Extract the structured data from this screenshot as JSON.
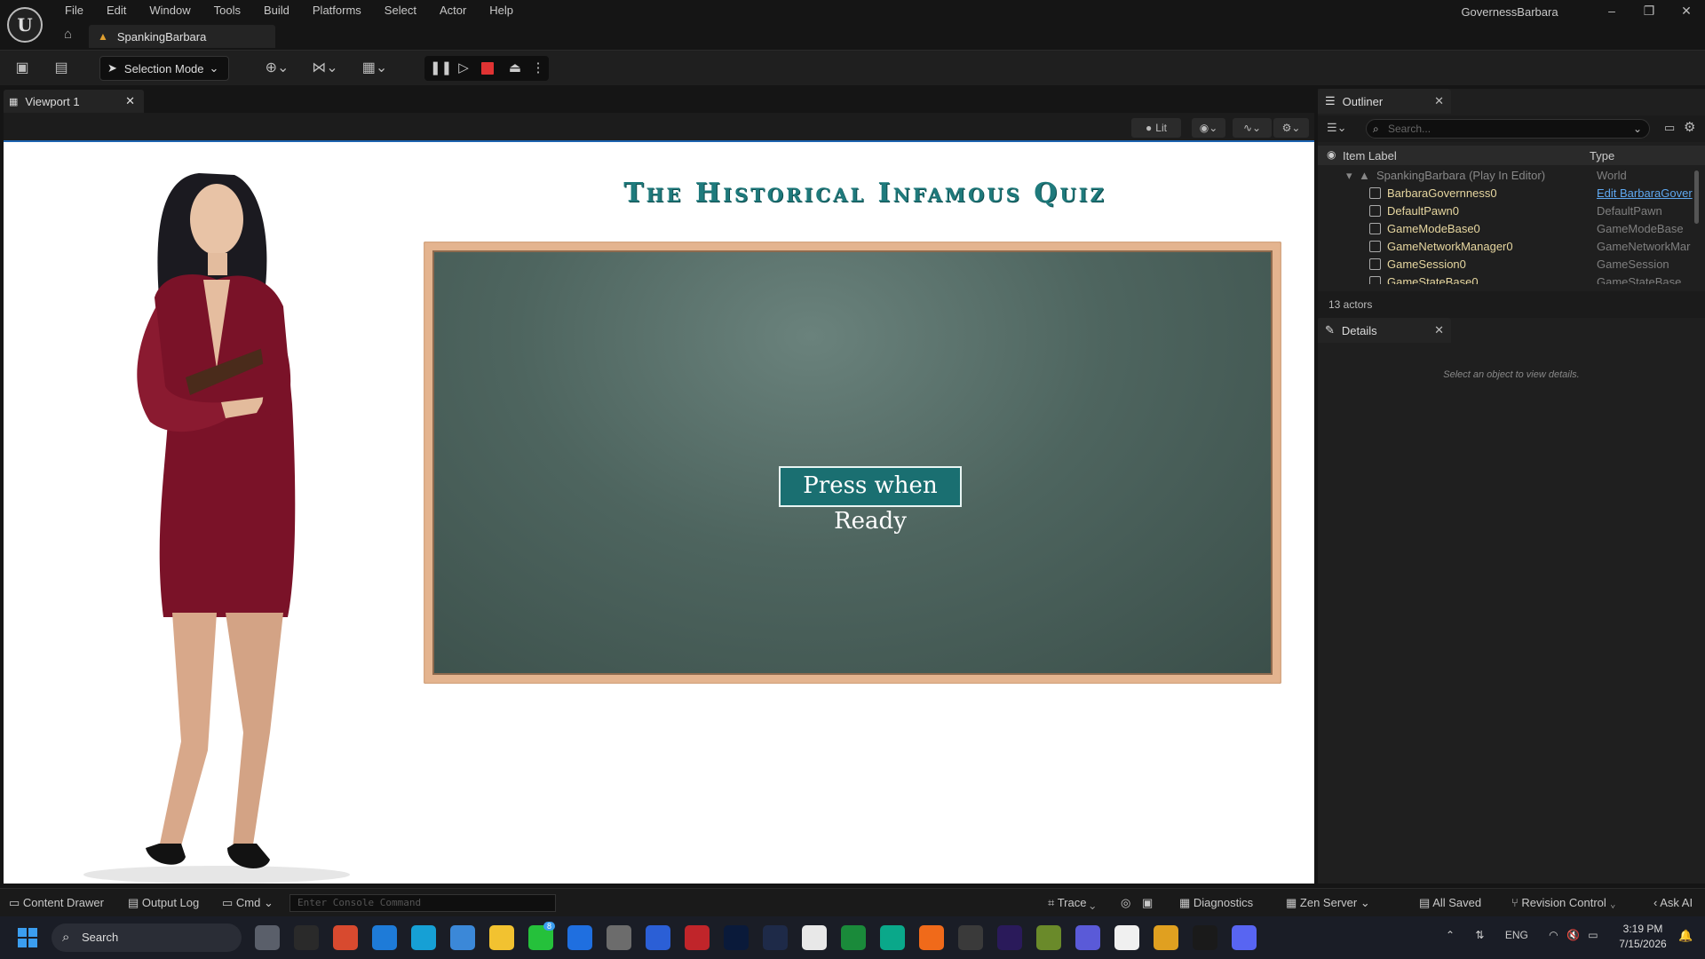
{
  "app": {
    "logo_letter": "U",
    "menus": [
      "File",
      "Edit",
      "Window",
      "Tools",
      "Build",
      "Platforms",
      "Select",
      "Actor",
      "Help"
    ],
    "level_tab": "SpankingBarbara",
    "project_name": "GovernessBarbara",
    "window_controls": {
      "minimize": "–",
      "restore": "❐",
      "close": "✕"
    }
  },
  "toolbar": {
    "mode_label": "Selection Mode"
  },
  "viewport": {
    "tab_label": "Viewport 1",
    "lit_label": "Lit"
  },
  "game": {
    "title": "The Historical Infamous Quiz",
    "button_label": "Press when Ready"
  },
  "outliner": {
    "tab_label": "Outliner",
    "search_placeholder": "Search...",
    "col_label": "Item Label",
    "col_type": "Type",
    "world": {
      "label": "SpankingBarbara (Play In Editor)",
      "type": "World"
    },
    "rows": [
      {
        "label": "BarbaraGovernness0",
        "type": "Edit BarbaraGover",
        "link": true
      },
      {
        "label": "DefaultPawn0",
        "type": "DefaultPawn"
      },
      {
        "label": "GameModeBase0",
        "type": "GameModeBase"
      },
      {
        "label": "GameNetworkManager0",
        "type": "GameNetworkMar"
      },
      {
        "label": "GameSession0",
        "type": "GameSession"
      },
      {
        "label": "GameStateBase0",
        "type": "GameStateBase"
      }
    ],
    "footer": "13 actors"
  },
  "details": {
    "tab_label": "Details",
    "hint": "Select an object to view details."
  },
  "statusbar": {
    "content_drawer": "Content Drawer",
    "output_log": "Output Log",
    "cmd": "Cmd",
    "console_placeholder": "Enter Console Command",
    "trace": "Trace",
    "diagnostics": "Diagnostics",
    "zen_server": "Zen Server",
    "all_saved": "All Saved",
    "revision_control": "Revision Control",
    "ask_ai": "Ask AI"
  },
  "taskbar": {
    "search_label": "Search",
    "badge_count": "8",
    "lang": "ENG",
    "time": "3:19 PM",
    "date": "7/15/2026",
    "apps": [
      "#5a5f6a",
      "#2a2a2a",
      "#d84a2f",
      "#1e7bd8",
      "#16a0d5",
      "#3b88d8",
      "#f2c230",
      "#25c13b",
      "#1f6fe0",
      "#6c6c6c",
      "#2b5fd6",
      "#c0252a",
      "#0a1a3a",
      "#1e2a48",
      "#e8e8e8",
      "#1a8a3a",
      "#0aa88a",
      "#f06a1a",
      "#3a3a3a",
      "#2a1a5a",
      "#6a8a2a",
      "#5a5ad8",
      "#f0f0f0",
      "#e0a020",
      "#1a1a1a",
      "#5865f2"
    ]
  },
  "colors": {
    "title_teal": "#1f7a7c",
    "button_teal": "#1a6f71",
    "accent_blue": "#1d63b0",
    "stop_red": "#e03333",
    "outliner_label": "#e7d7a0"
  }
}
